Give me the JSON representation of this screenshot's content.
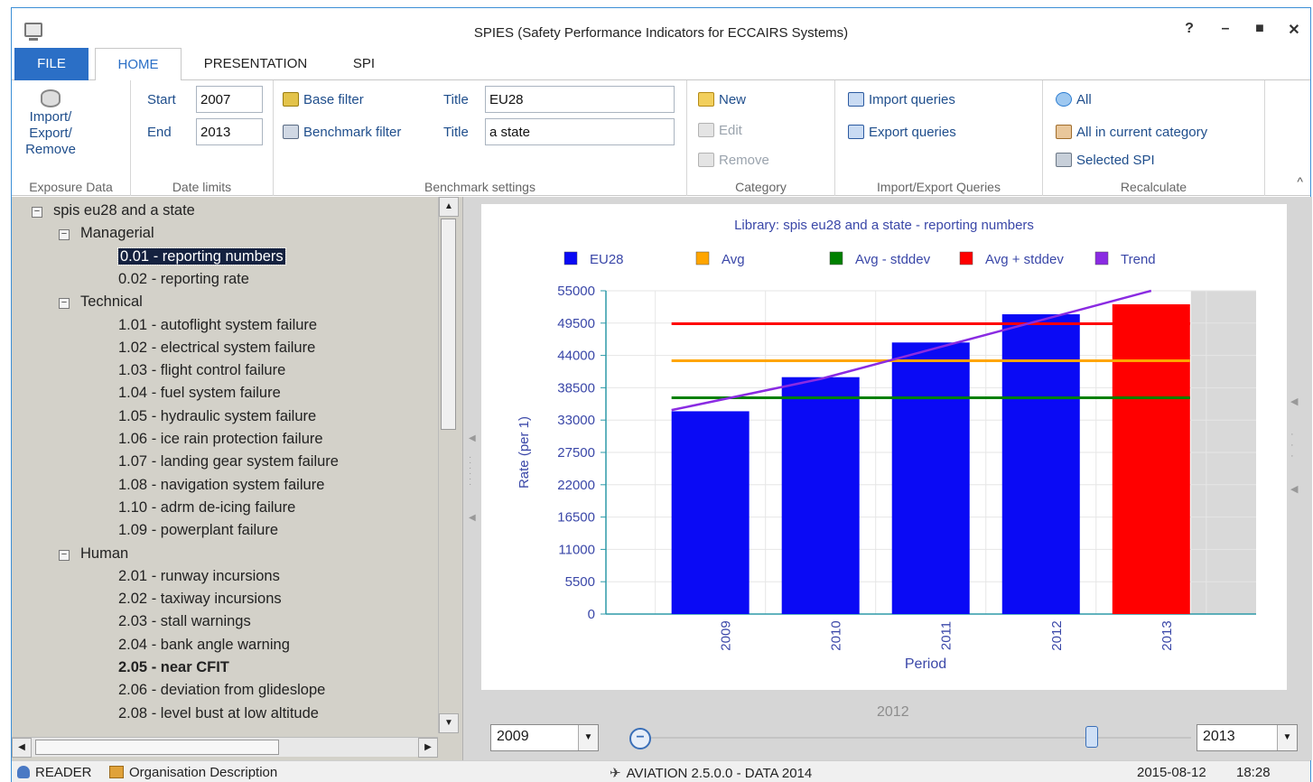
{
  "window": {
    "title": "SPIES (Safety Performance Indicators for ECCAIRS Systems)",
    "help": "?",
    "minimize": "–",
    "maximize": "■",
    "close": "✕"
  },
  "tabs": {
    "file": "FILE",
    "home": "HOME",
    "presentation": "PRESENTATION",
    "spi": "SPI"
  },
  "ribbon": {
    "exposure": {
      "button_label_1": "Import/",
      "button_label_2": "Export/",
      "button_label_3": "Remove",
      "group_label": "Exposure Data"
    },
    "dates": {
      "start_label": "Start",
      "start_value": "2007",
      "end_label": "End",
      "end_value": "2013",
      "group_label": "Date limits"
    },
    "benchmark": {
      "base_filter": "Base filter",
      "benchmark_filter": "Benchmark filter",
      "title_label": "Title",
      "base_title": "EU28",
      "benchmark_title": "a state",
      "group_label": "Benchmark settings"
    },
    "category": {
      "new": "New",
      "edit": "Edit",
      "remove": "Remove",
      "group_label": "Category"
    },
    "queries": {
      "import": "Import queries",
      "export": "Export queries",
      "group_label": "Import/Export Queries"
    },
    "recalculate": {
      "all": "All",
      "all_in_category": "All in current category",
      "selected": "Selected SPI",
      "group_label": "Recalculate"
    },
    "collapse": "^"
  },
  "tree": {
    "root": "spis eu28 and a state",
    "groups": [
      {
        "label": "Managerial",
        "items": [
          {
            "label": "0.01 - reporting numbers",
            "selected": true
          },
          {
            "label": "0.02 - reporting rate"
          }
        ]
      },
      {
        "label": "Technical",
        "items": [
          {
            "label": "1.01 - autoflight system failure"
          },
          {
            "label": "1.02 - electrical system failure"
          },
          {
            "label": "1.03 - flight control failure"
          },
          {
            "label": "1.04 - fuel system failure"
          },
          {
            "label": "1.05 - hydraulic system failure"
          },
          {
            "label": "1.06 - ice rain protection failure"
          },
          {
            "label": "1.07 - landing gear system failure"
          },
          {
            "label": "1.08 - navigation system failure"
          },
          {
            "label": "1.10 - adrm de-icing failure"
          },
          {
            "label": "1.09 - powerplant failure"
          }
        ]
      },
      {
        "label": "Human",
        "items": [
          {
            "label": "2.01 - runway incursions"
          },
          {
            "label": "2.02 - taxiway incursions"
          },
          {
            "label": "2.03 - stall warnings"
          },
          {
            "label": "2.04 - bank angle warning"
          },
          {
            "label": "2.05 - near CFIT",
            "bold": true
          },
          {
            "label": "2.06 - deviation from glideslope"
          },
          {
            "label": "2.08 - level bust at low altitude"
          }
        ]
      }
    ]
  },
  "chart_data": {
    "type": "bar",
    "title": "Library: spis eu28 and a state - reporting numbers",
    "xlabel": "Period",
    "ylabel": "Rate (per 1)",
    "categories": [
      "2009",
      "2010",
      "2011",
      "2012",
      "2013"
    ],
    "ylim": [
      0,
      55000
    ],
    "yticks": [
      "55000",
      "49500",
      "44000",
      "38500",
      "33000",
      "27500",
      "22000",
      "16500",
      "11000",
      "5500",
      "0"
    ],
    "series": [
      {
        "name": "EU28",
        "values": [
          34500,
          40300,
          46200,
          51000,
          52700
        ],
        "colors": [
          "#0a0af5",
          "#0a0af5",
          "#0a0af5",
          "#0a0af5",
          "#ff0000"
        ]
      },
      {
        "name": "Avg",
        "values": [
          43100,
          43100,
          43100,
          43100,
          43100
        ],
        "color": "#ffa500"
      },
      {
        "name": "Avg - stddev",
        "values": [
          36800,
          36800,
          36800,
          36800,
          36800
        ],
        "color": "#008000"
      },
      {
        "name": "Avg + stddev",
        "values": [
          49400,
          49400,
          49400,
          49400,
          49400
        ],
        "color": "#ff0000"
      },
      {
        "name": "Trend",
        "values": [
          34700,
          40000,
          45000,
          50000,
          55000
        ],
        "color": "#8a2be2"
      }
    ],
    "legend_position": "top",
    "grid": true
  },
  "period": {
    "label": "2012",
    "from": "2009",
    "to": "2013",
    "position_fraction": 0.82
  },
  "status": {
    "mode": "READER",
    "organisation": "Organisation Description",
    "version": "AVIATION 2.5.0.0 - DATA 2014",
    "date": "2015-08-12",
    "time": "18:28"
  }
}
